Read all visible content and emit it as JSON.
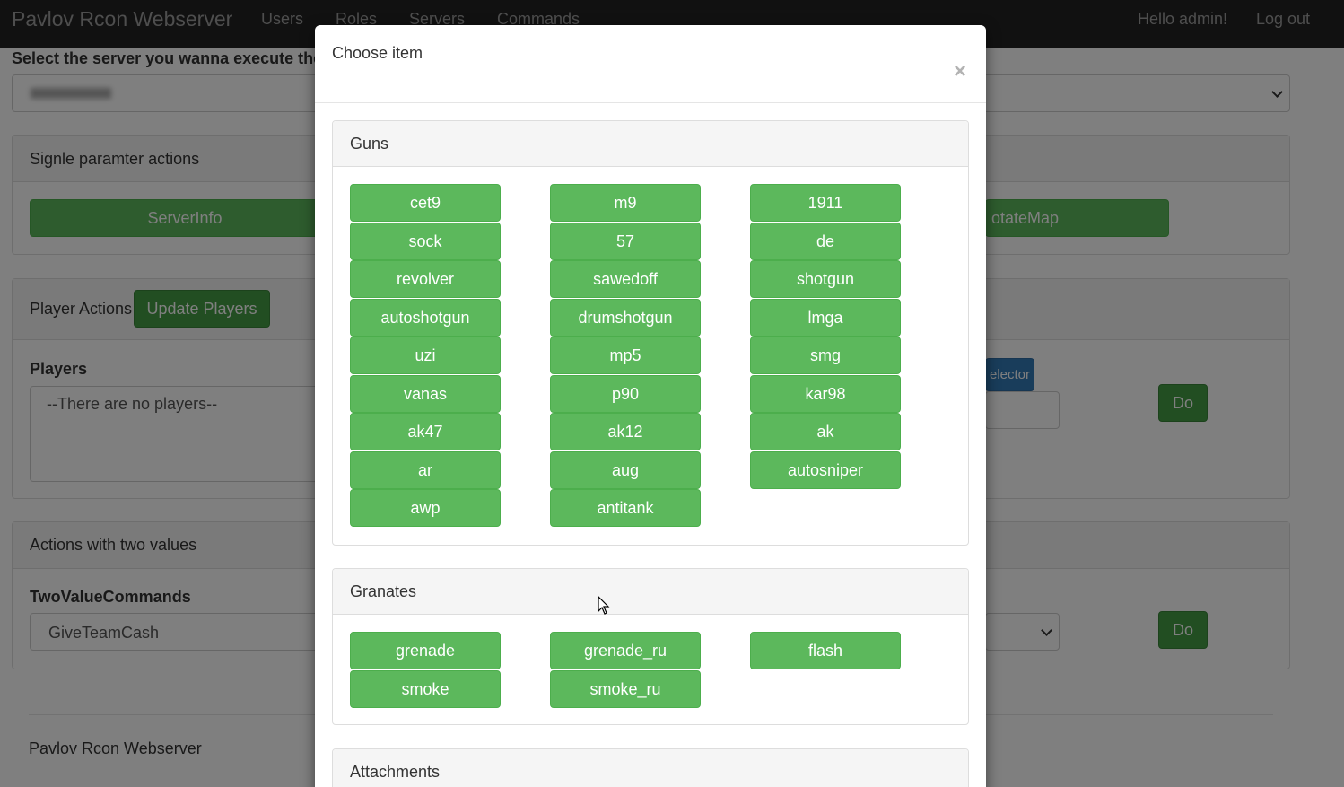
{
  "navbar": {
    "brand": "Pavlov Rcon Webserver",
    "links": [
      "Users",
      "Roles",
      "Servers",
      "Commands"
    ],
    "greeting": "Hello admin!",
    "logout": "Log out"
  },
  "page": {
    "server_prompt": "Select the server you wanna execute the",
    "single_param_title": "Signle paramter actions",
    "serverinfo_button": "ServerInfo",
    "rotatemap_button": "otateMap",
    "player_actions_title": "Player Actions",
    "update_players_button": "Update Players",
    "players_label": "Players",
    "players_placeholder": "--There are no players--",
    "selector_button": "elector",
    "do_button": "Do",
    "two_values_title": "Actions with two values",
    "two_value_label": "TwoValueCommands",
    "two_value_selected": "GiveTeamCash",
    "do_button_2": "Do",
    "footer": "Pavlov Rcon Webserver"
  },
  "modal": {
    "title": "Choose item",
    "close": "×",
    "sections": [
      {
        "title": "Guns",
        "items": [
          "cet9",
          "m9",
          "1911",
          "sock",
          "57",
          "de",
          "revolver",
          "sawedoff",
          "shotgun",
          "autoshotgun",
          "drumshotgun",
          "lmga",
          "uzi",
          "mp5",
          "smg",
          "vanas",
          "p90",
          "kar98",
          "ak47",
          "ak12",
          "ak",
          "ar",
          "aug",
          "autosniper",
          "awp",
          "antitank"
        ]
      },
      {
        "title": "Granates",
        "items": [
          "grenade",
          "grenade_ru",
          "flash",
          "smoke",
          "smoke_ru"
        ]
      },
      {
        "title": "Attachments",
        "items": []
      }
    ]
  },
  "colors": {
    "navbar": "#222222",
    "success": "#5cb85c",
    "primary": "#337ab7"
  }
}
